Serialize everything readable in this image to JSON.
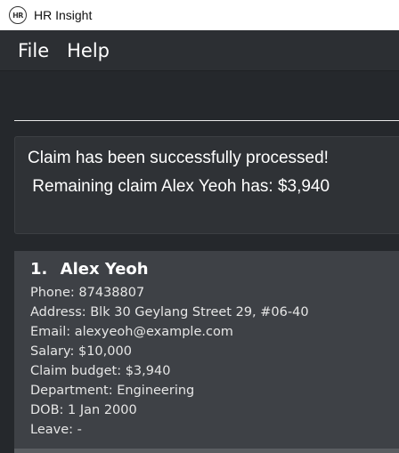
{
  "window": {
    "icon_text": "HR",
    "title": "HR Insight"
  },
  "menu": {
    "items": [
      "File",
      "Help"
    ]
  },
  "command": {
    "value": "",
    "placeholder": ""
  },
  "result": {
    "text": "Claim has been successfully processed!\n Remaining claim Alex Yeoh has: $3,940"
  },
  "persons": [
    {
      "index": "1.",
      "name": "Alex Yeoh",
      "phone": "Phone: 87438807",
      "address": "Address: Blk 30 Geylang Street 29, #06-40",
      "email": "Email: alexyeoh@example.com",
      "salary": "Salary: $10,000",
      "claim_budget": "Claim budget: $3,940",
      "department": "Department: Engineering",
      "dob": "DOB: 1 Jan 2000",
      "leave": "Leave: -"
    }
  ]
}
